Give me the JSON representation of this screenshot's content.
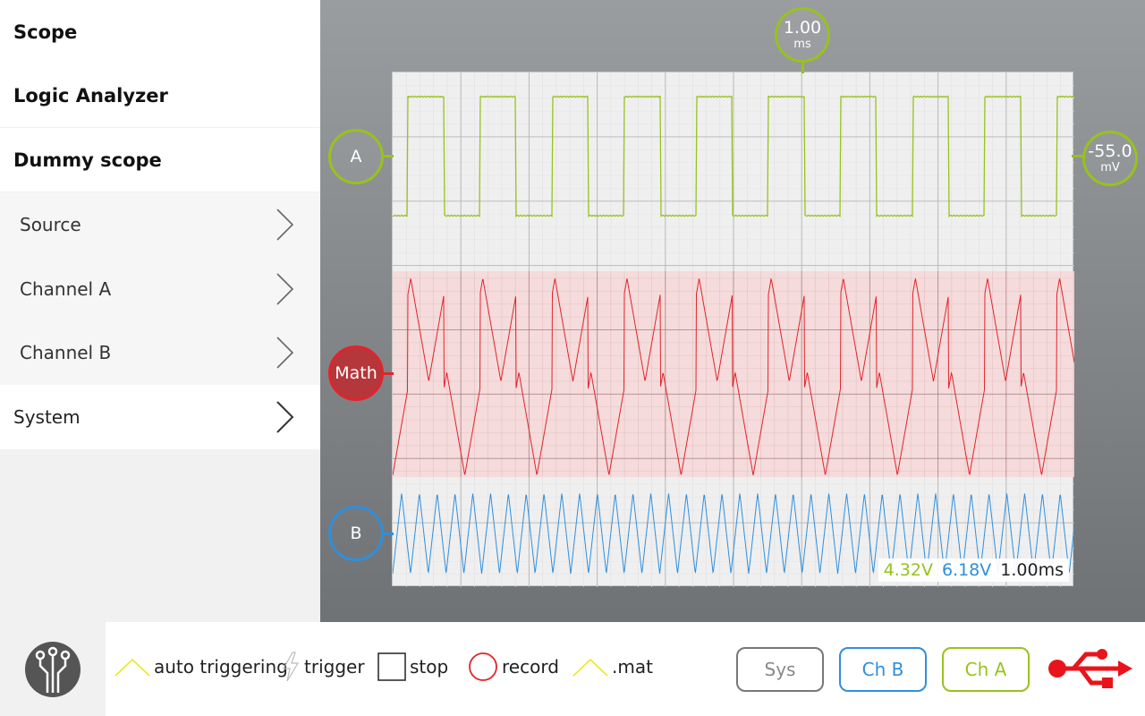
{
  "sidebar": {
    "top_items": [
      {
        "label": "Scope"
      },
      {
        "label": "Logic Analyzer"
      },
      {
        "label": "Dummy scope"
      }
    ],
    "sub_items": [
      {
        "label": "Source"
      },
      {
        "label": "Channel A"
      },
      {
        "label": "Channel B"
      }
    ],
    "system_label": "System"
  },
  "scope": {
    "timebase_value": "1.00",
    "timebase_unit": "ms",
    "channel_a_label": "A",
    "math_label": "Math",
    "channel_b_label": "B",
    "trigger_value": "-55.0",
    "trigger_unit": "mV",
    "readout": {
      "channel_a": "4.32V",
      "channel_b": "6.18V",
      "time": "1.00ms"
    },
    "colors": {
      "channel_a": "#98c21d",
      "math": "#e0242b",
      "channel_b": "#2f8fdc"
    }
  },
  "toolbar": {
    "auto_triggering_label": "auto triggering",
    "trigger_label": "trigger",
    "stop_label": "stop",
    "record_label": "record",
    "mat_label": ".mat",
    "sys_button": "Sys",
    "ch_b_button": "Ch B",
    "ch_a_button": "Ch A",
    "icons": [
      "logo-icon",
      "auto-trigger-icon",
      "trigger-bolt-icon",
      "stop-icon",
      "record-icon",
      "mat-icon",
      "usb-icon"
    ]
  }
}
